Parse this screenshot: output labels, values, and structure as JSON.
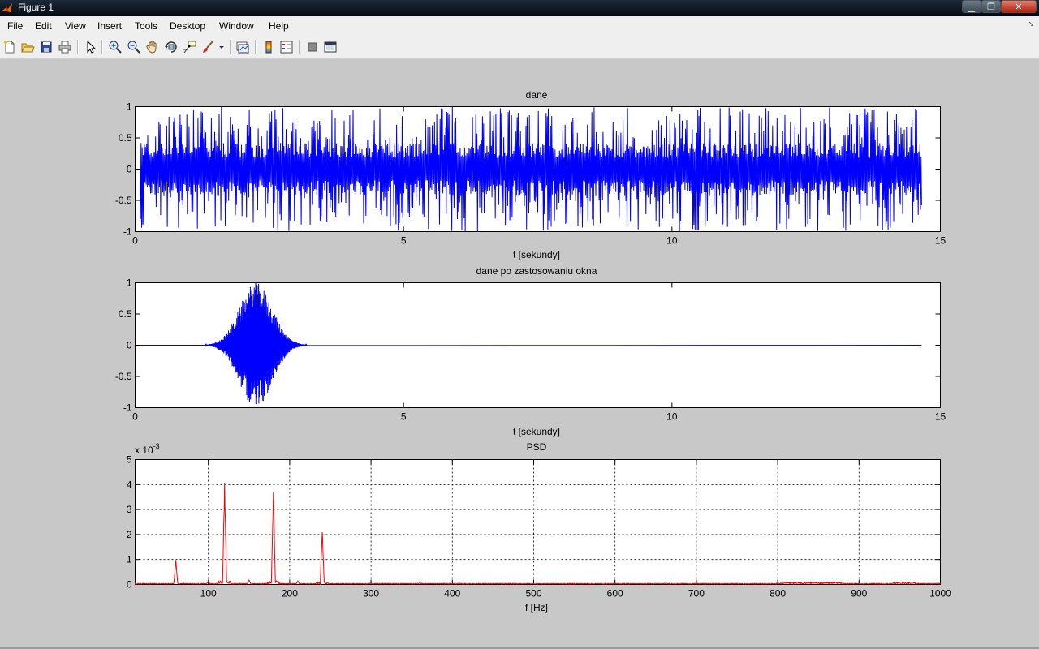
{
  "window": {
    "title": "Figure 1",
    "close_glyph": "✕",
    "min_glyph": "▁",
    "max_glyph": "❐"
  },
  "menu": [
    "File",
    "Edit",
    "View",
    "Insert",
    "Tools",
    "Desktop",
    "Window",
    "Help"
  ],
  "menu_dock_glyph": "↘",
  "toolbar_icons": [
    "new-figure-icon",
    "open-file-icon",
    "save-icon",
    "print-icon",
    "edit-plot-arrow-icon",
    "zoom-in-icon",
    "zoom-out-icon",
    "pan-hand-icon",
    "rotate-3d-icon",
    "data-cursor-icon",
    "brush-icon",
    "link-plot-icon",
    "insert-colorbar-icon",
    "insert-legend-icon",
    "hide-plot-tools-icon",
    "show-plot-tools-icon"
  ],
  "colors": {
    "signal": "#0000ff",
    "psd": "#ff0000",
    "axes_bg": "#ffffff",
    "figure_bg": "#c8c8c8"
  },
  "chart_data": [
    {
      "type": "line",
      "title": "dane",
      "xlabel": "t [sekundy]",
      "ylabel": "",
      "xlim": [
        0,
        15
      ],
      "ylim": [
        -1,
        1
      ],
      "xticks": [
        "0",
        "5",
        "10",
        "15"
      ],
      "yticks": [
        "1",
        "0.5",
        "0",
        "-0.5",
        "-1"
      ],
      "grid": false,
      "series": [
        {
          "color": "#0000ff",
          "signal_span_s": [
            0.1,
            14.65
          ],
          "amplitude_typical": 0.3,
          "amplitude_peak": 1.0
        }
      ]
    },
    {
      "type": "line",
      "title": "dane po zastosowaniu okna",
      "xlabel": "t [sekundy]",
      "ylabel": "",
      "xlim": [
        0,
        15
      ],
      "ylim": [
        -1,
        1
      ],
      "xticks": [
        "0",
        "5",
        "10",
        "15"
      ],
      "yticks": [
        "1",
        "0.5",
        "0",
        "-0.5",
        "-1"
      ],
      "grid": false,
      "series": [
        {
          "color": "#0000ff",
          "window_span_s": [
            1.3,
            3.2
          ],
          "window_center_s": 2.25,
          "amplitude_peak": 1.0,
          "flat_until_s": 14.65
        }
      ]
    },
    {
      "type": "line",
      "title": "PSD",
      "xlabel": "f [Hz]",
      "ylabel": "",
      "scale_label": "x 10",
      "scale_exponent": "-3",
      "xlim": [
        10,
        1000
      ],
      "ylim": [
        0,
        5
      ],
      "xticks": [
        "100",
        "200",
        "300",
        "400",
        "500",
        "600",
        "700",
        "800",
        "900",
        "1000"
      ],
      "yticks": [
        "5",
        "4",
        "3",
        "2",
        "1",
        "0"
      ],
      "grid": true,
      "series": [
        {
          "color": "#ff0000",
          "peaks": [
            {
              "f": 60,
              "v": 1.0
            },
            {
              "f": 120,
              "v": 4.3
            },
            {
              "f": 180,
              "v": 3.95
            },
            {
              "f": 240,
              "v": 2.35
            },
            {
              "f": 100,
              "v": 0.15
            },
            {
              "f": 150,
              "v": 0.2
            },
            {
              "f": 210,
              "v": 0.15
            },
            {
              "f": 300,
              "v": 0.08
            },
            {
              "f": 360,
              "v": 0.08
            }
          ]
        }
      ]
    }
  ]
}
